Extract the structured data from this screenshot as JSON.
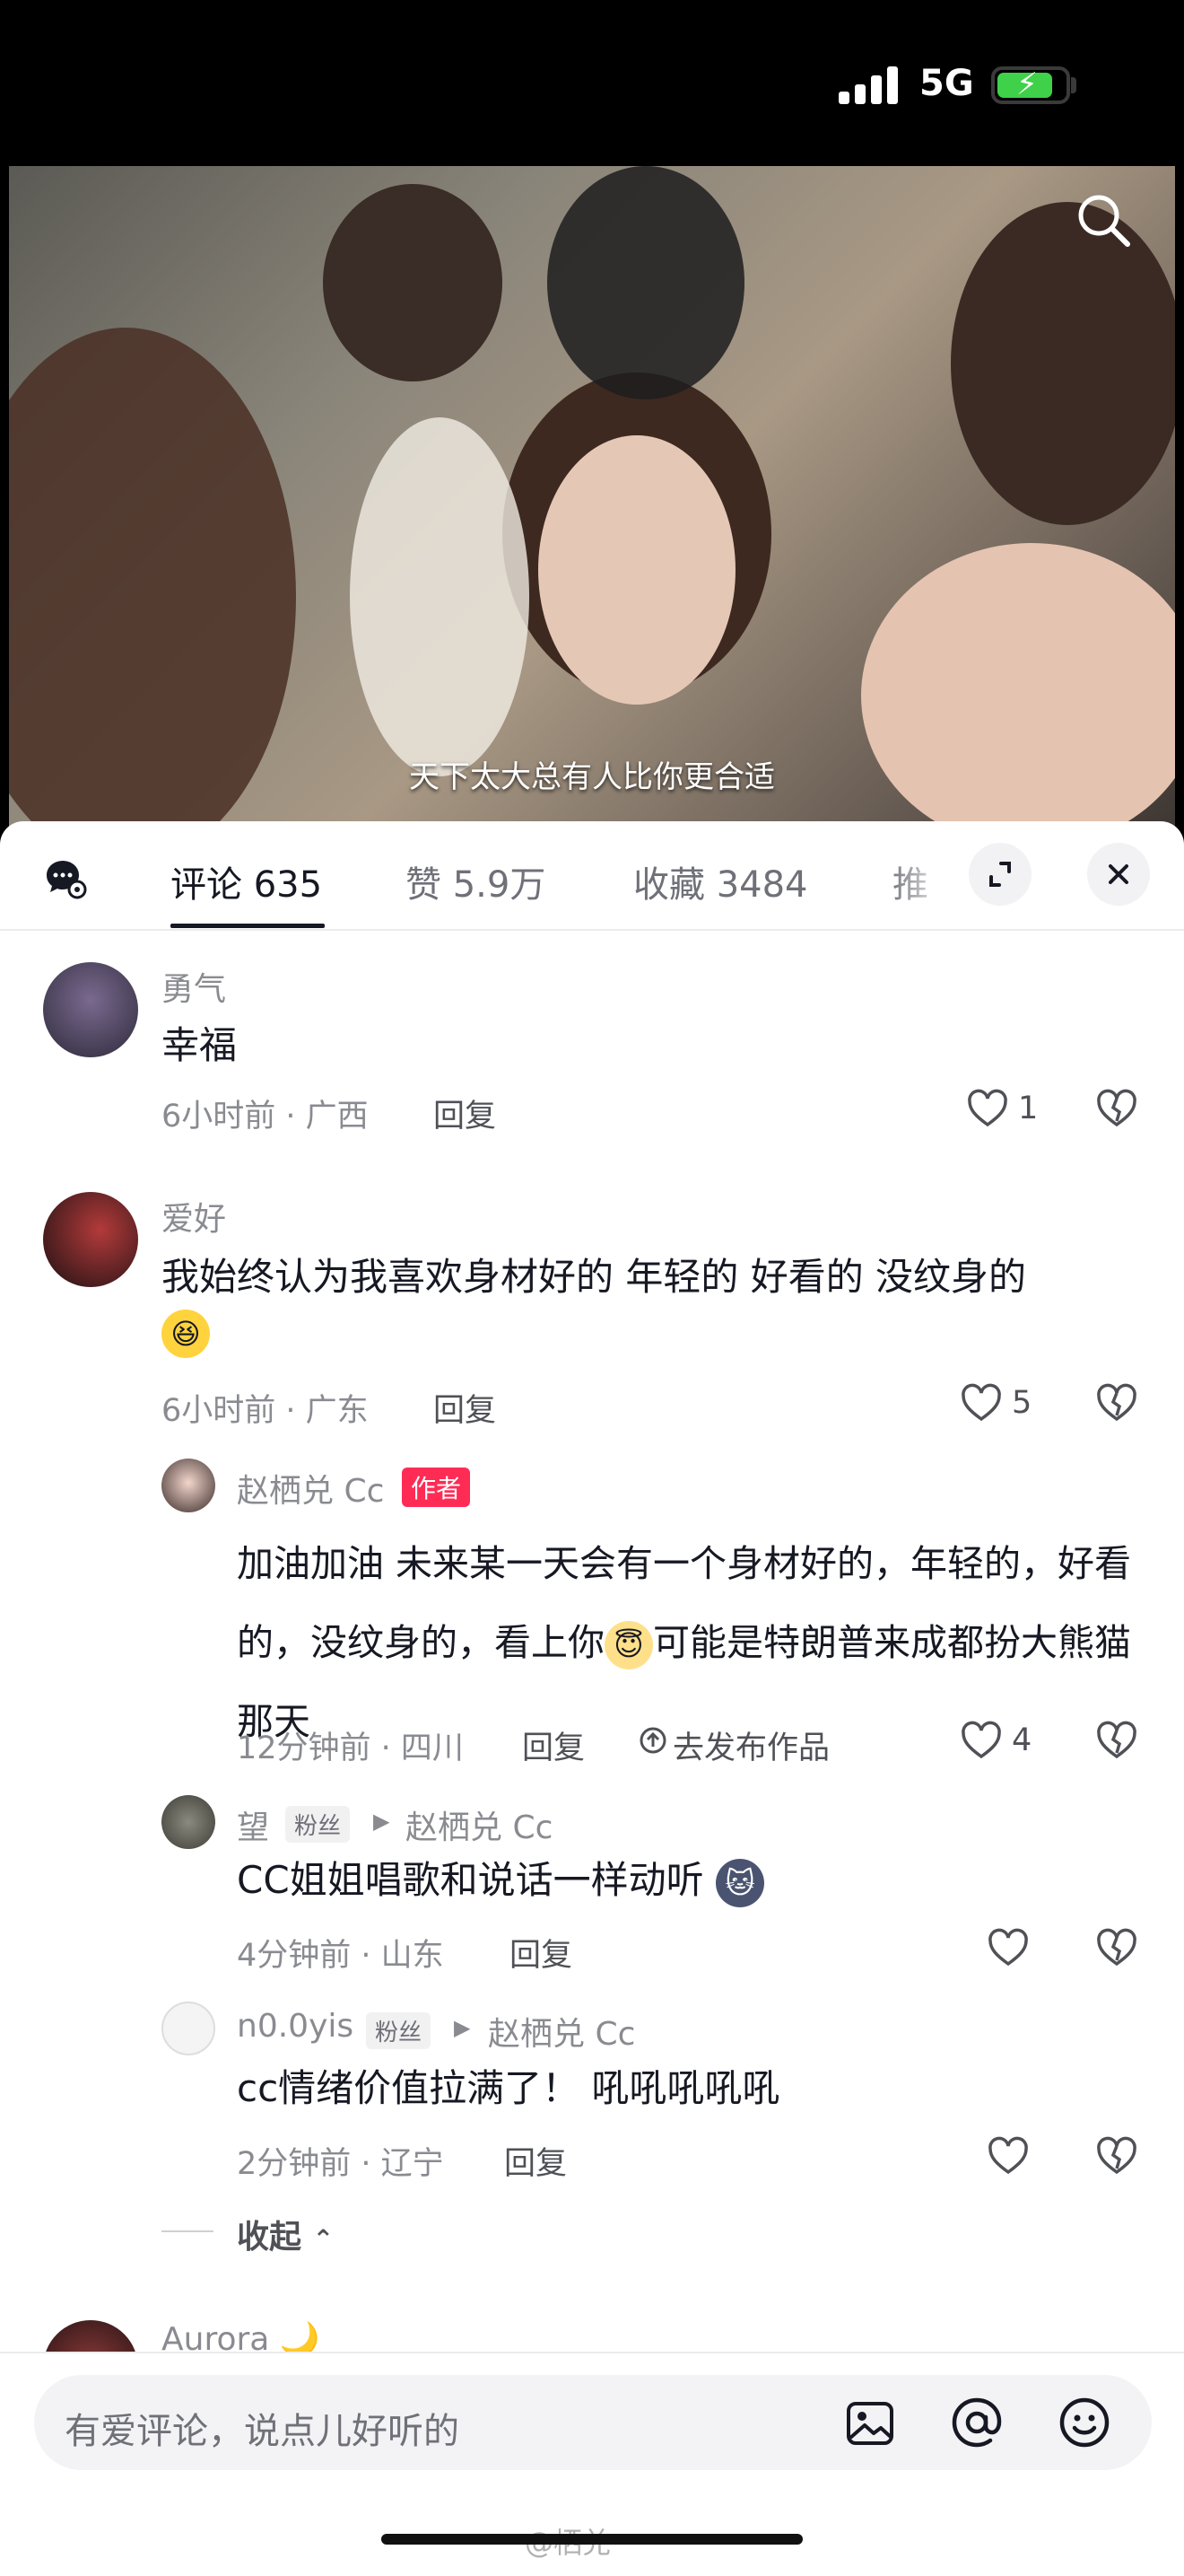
{
  "status_bar": {
    "network": "5G",
    "battery_level": 0.82
  },
  "video": {
    "subtitle": "天下太大总有人比你更合适"
  },
  "tabs": [
    {
      "label": "评论 635"
    },
    {
      "label": "赞 5.9万"
    },
    {
      "label": "收藏 3484"
    },
    {
      "label": "推"
    }
  ],
  "comments": [
    {
      "user": "勇气",
      "text": "幸福",
      "time_location": "6小时前 · 广西",
      "reply": "回复",
      "likes": "1"
    },
    {
      "user": "爱好",
      "text": "我始终认为我喜欢身材好的  年轻的  好看的  没纹身的",
      "time_location": "6小时前 · 广东",
      "reply": "回复",
      "likes": "5"
    }
  ],
  "replies": [
    {
      "user": "赵栖兑 Cc",
      "badge": "作者",
      "text_before_emoji": "加油加油 未来某一天会有一个身材好的，年轻的，好看的，没纹身的，看上你",
      "text_after_emoji": "可能是特朗普来成都扮大熊猫那天",
      "time_location": "12分钟前 · 四川",
      "reply": "回复",
      "publish": "去发布作品",
      "likes": "4"
    },
    {
      "user": "望",
      "badge": "粉丝",
      "reply_to": "赵栖兑 Cc",
      "text": "CC姐姐唱歌和说话一样动听",
      "time_location": "4分钟前 · 山东",
      "reply": "回复"
    },
    {
      "user": "n0.0yis",
      "badge": "粉丝",
      "reply_to": "赵栖兑 Cc",
      "text": "cc情绪价值拉满了！ 吼吼吼吼吼",
      "time_location": "2分钟前 · 辽宁",
      "reply": "回复"
    }
  ],
  "collapse_label": "收起",
  "next_comment_user": "Aurora",
  "input": {
    "placeholder": "有爱评论，说点儿好听的"
  },
  "watermark": "@栖兑"
}
